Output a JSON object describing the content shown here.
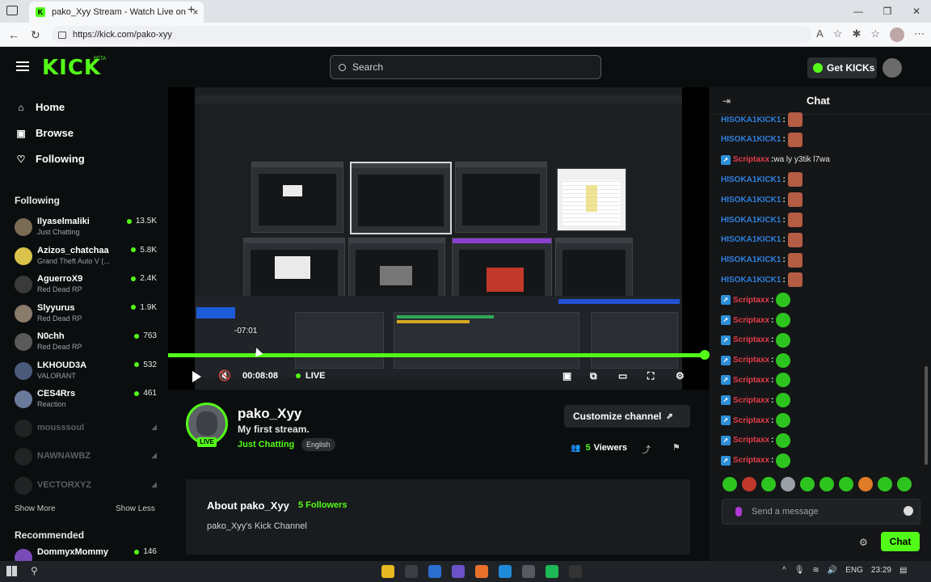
{
  "browser": {
    "tab_title": "pako_Xyy Stream - Watch Live on Kick",
    "favicon": "K",
    "url": "https://kick.com/pako-xyy",
    "new_tab": "+",
    "tab_close": "×"
  },
  "header": {
    "logo": "KICK",
    "logo_beta": "BETA",
    "search_placeholder": "Search",
    "get_kicks": "Get KICKs"
  },
  "sidebar": {
    "nav": [
      {
        "label": "Home",
        "icon": "home-icon"
      },
      {
        "label": "Browse",
        "icon": "browse-icon"
      },
      {
        "label": "Following",
        "icon": "heart-icon"
      }
    ],
    "following_title": "Following",
    "channels": [
      {
        "name": "Ilyaselmaliki",
        "game": "Just Chatting",
        "viewers": "13.5K",
        "avatar_color": "#7a6b55"
      },
      {
        "name": "Azizos_chatchaa",
        "game": "Grand Theft Auto V (...",
        "viewers": "5.8K",
        "avatar_color": "#d9c34a"
      },
      {
        "name": "AguerroX9",
        "game": "Red Dead RP",
        "viewers": "2.4K",
        "avatar_color": "#3a3a3a"
      },
      {
        "name": "Slyyurus",
        "game": "Red Dead RP",
        "viewers": "1.9K",
        "avatar_color": "#8a7a6a"
      },
      {
        "name": "N0chh",
        "game": "Red Dead RP",
        "viewers": "763",
        "avatar_color": "#5a5a5a"
      },
      {
        "name": "LKHOUD3A",
        "game": "VALORANT",
        "viewers": "532",
        "avatar_color": "#4a5a7a"
      },
      {
        "name": "CES4Rrs",
        "game": "Reaction",
        "viewers": "461",
        "avatar_color": "#6a7a9a"
      }
    ],
    "offline_channels": [
      "mousssoul",
      "NAWNAWBZ",
      "VECTORXYZ"
    ],
    "show_more": "Show More",
    "show_less": "Show Less",
    "recommended_title": "Recommended",
    "recommended": [
      {
        "name": "DommyxMommy",
        "viewers": "146"
      }
    ]
  },
  "player": {
    "time_tooltip": "-07:01",
    "elapsed": "00:08:08",
    "live_label": "LIVE",
    "progress_fraction": 1.0
  },
  "channel": {
    "name": "pako_Xyy",
    "stream_title": "My first stream.",
    "category": "Just Chatting",
    "language": "English",
    "live_badge": "LIVE",
    "customize_label": "Customize channel",
    "viewers_count": "5",
    "viewers_label": "Viewers"
  },
  "about": {
    "title": "About pako_Xyy",
    "followers": "5 Followers",
    "description": "pako_Xyy's Kick Channel"
  },
  "chat": {
    "title": "Chat",
    "messages": [
      {
        "user": "HISOKA1KICK1",
        "text": "",
        "emote": "face",
        "color": "#2f7fe0",
        "badge": false
      },
      {
        "user": "HISOKA1KICK1",
        "text": "",
        "emote": "face",
        "color": "#2f7fe0",
        "badge": false
      },
      {
        "user": "Scriptaxx",
        "text": "wa ly y3tik l7wa",
        "emote": "",
        "color": "#e83c4c",
        "badge": true
      },
      {
        "user": "HISOKA1KICK1",
        "text": "",
        "emote": "face",
        "color": "#2f7fe0",
        "badge": false
      },
      {
        "user": "HISOKA1KICK1",
        "text": "",
        "emote": "face",
        "color": "#2f7fe0",
        "badge": false
      },
      {
        "user": "HISOKA1KICK1",
        "text": "",
        "emote": "face",
        "color": "#2f7fe0",
        "badge": false
      },
      {
        "user": "HISOKA1KICK1",
        "text": "",
        "emote": "face",
        "color": "#2f7fe0",
        "badge": false
      },
      {
        "user": "HISOKA1KICK1",
        "text": "",
        "emote": "face",
        "color": "#2f7fe0",
        "badge": false
      },
      {
        "user": "HISOKA1KICK1",
        "text": "",
        "emote": "face",
        "color": "#2f7fe0",
        "badge": false
      },
      {
        "user": "Scriptaxx",
        "text": "",
        "emote": "green",
        "color": "#e83c4c",
        "badge": true
      },
      {
        "user": "Scriptaxx",
        "text": "",
        "emote": "green",
        "color": "#e83c4c",
        "badge": true
      },
      {
        "user": "Scriptaxx",
        "text": "",
        "emote": "green",
        "color": "#e83c4c",
        "badge": true
      },
      {
        "user": "Scriptaxx",
        "text": "",
        "emote": "green",
        "color": "#e83c4c",
        "badge": true
      },
      {
        "user": "Scriptaxx",
        "text": "",
        "emote": "green",
        "color": "#e83c4c",
        "badge": true
      },
      {
        "user": "Scriptaxx",
        "text": "",
        "emote": "green",
        "color": "#e83c4c",
        "badge": true
      },
      {
        "user": "Scriptaxx",
        "text": "",
        "emote": "green",
        "color": "#e83c4c",
        "badge": true
      },
      {
        "user": "Scriptaxx",
        "text": "",
        "emote": "green",
        "color": "#e83c4c",
        "badge": true
      },
      {
        "user": "Scriptaxx",
        "text": "",
        "emote": "green",
        "color": "#e83c4c",
        "badge": true
      }
    ],
    "input_placeholder": "Send a message",
    "send_label": "Chat",
    "emote_colors": [
      "#2ec41f",
      "#c0392b",
      "#2ec41f",
      "#9aa0a6",
      "#2ec41f",
      "#2ec41f",
      "#2ec41f",
      "#e07b27",
      "#2ec41f",
      "#2ec41f"
    ]
  },
  "taskbar": {
    "language": "ENG",
    "time": "23:29",
    "app_colors": [
      "#e8b923",
      "#3b3f44",
      "#2a6fd0",
      "#6b52c8",
      "#e8702a",
      "#1f8ad8",
      "#555a60",
      "#1db954",
      "#333"
    ]
  },
  "colors": {
    "brand_green": "#53fc18",
    "background": "#0b0e0f"
  }
}
